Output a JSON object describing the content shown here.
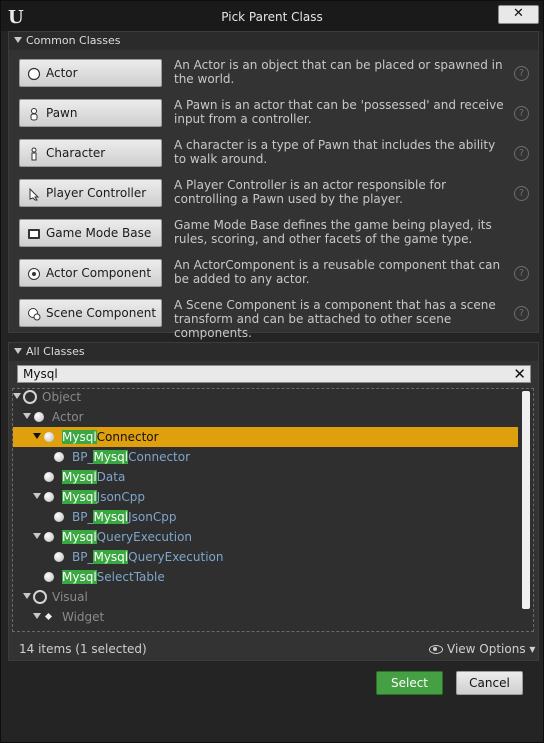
{
  "window": {
    "title": "Pick Parent Class",
    "close_label": "✕"
  },
  "common": {
    "heading": "Common Classes",
    "items": [
      {
        "label": "Actor",
        "desc": "An Actor is an object that can be placed or spawned in the world.",
        "icon": "actor-icon"
      },
      {
        "label": "Pawn",
        "desc": "A Pawn is an actor that can be 'possessed' and receive input from a controller.",
        "icon": "pawn-icon"
      },
      {
        "label": "Character",
        "desc": "A character is a type of Pawn that includes the ability to walk around.",
        "icon": "character-icon"
      },
      {
        "label": "Player Controller",
        "desc": "A Player Controller is an actor responsible for controlling a Pawn used by the player.",
        "icon": "player-controller-icon"
      },
      {
        "label": "Game Mode Base",
        "desc": "Game Mode Base defines the game being played, its rules, scoring, and other facets of the game type.",
        "icon": "game-mode-icon"
      },
      {
        "label": "Actor Component",
        "desc": "An ActorComponent is a reusable component that can be added to any actor.",
        "icon": "actor-component-icon"
      },
      {
        "label": "Scene Component",
        "desc": "A Scene Component is a component that has a scene transform and can be attached to other scene components.",
        "icon": "scene-component-icon"
      }
    ],
    "help_glyph": "?"
  },
  "all": {
    "heading": "All Classes",
    "search_value": "Mysql",
    "search_clear": "✕",
    "tree": [
      {
        "hl": "",
        "rest": "Object"
      },
      {
        "hl": "",
        "rest": "Actor"
      },
      {
        "hl": "Mysql",
        "rest": "Connector"
      },
      {
        "pre": "BP_",
        "hl": "Mysql",
        "rest": "Connector"
      },
      {
        "hl": "Mysql",
        "rest": "Data"
      },
      {
        "hl": "Mysql",
        "rest": "JsonCpp"
      },
      {
        "pre": "BP_",
        "hl": "Mysql",
        "rest": "JsonCpp"
      },
      {
        "hl": "Mysql",
        "rest": "QueryExecution"
      },
      {
        "pre": "BP_",
        "hl": "Mysql",
        "rest": "QueryExecution"
      },
      {
        "hl": "Mysql",
        "rest": "SelectTable"
      },
      {
        "hl": "",
        "rest": "Visual"
      },
      {
        "hl": "",
        "rest": "Widget"
      }
    ],
    "status": "14 items (1 selected)",
    "view_options": "View Options"
  },
  "footer": {
    "select_label": "Select",
    "cancel_label": "Cancel"
  },
  "colors": {
    "selected_row": "#e0a00e",
    "highlight": "#39a840",
    "select_button": "#44a043"
  }
}
